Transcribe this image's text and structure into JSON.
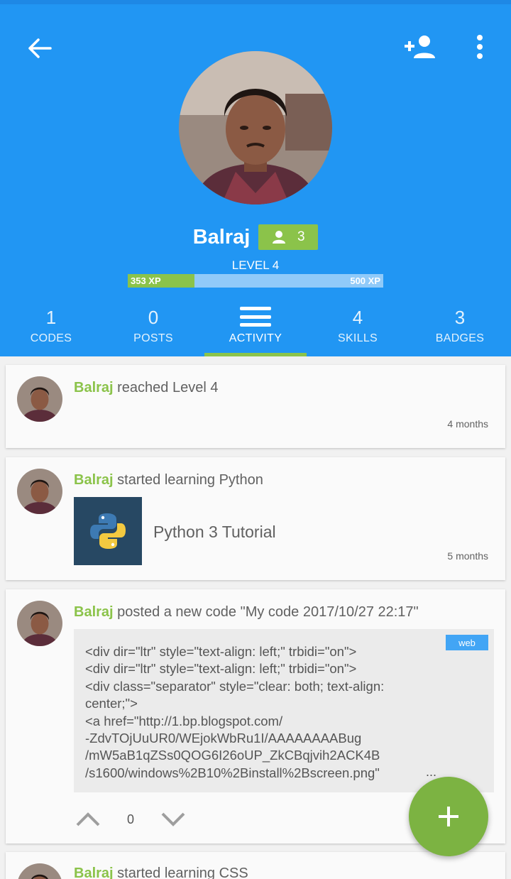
{
  "profile": {
    "name": "Balraj",
    "followers": "3",
    "level": "LEVEL 4",
    "xp_current": "353 XP",
    "xp_max": "500 XP",
    "xp_progress": 0.262
  },
  "tabs": [
    {
      "count": "1",
      "label": "CODES"
    },
    {
      "count": "0",
      "label": "POSTS"
    },
    {
      "count": "",
      "label": "ACTIVITY"
    },
    {
      "count": "4",
      "label": "SKILLS"
    },
    {
      "count": "3",
      "label": "BADGES"
    }
  ],
  "feed": [
    {
      "user": "Balraj",
      "text": " reached Level 4",
      "time": "4 months"
    },
    {
      "user": "Balraj",
      "text": " started learning Python",
      "course": "Python 3 Tutorial",
      "time": "5 months"
    },
    {
      "user": "Balraj",
      "text": " posted a new code \"My code 2017/10/27 22:17\"",
      "tag": "web",
      "code": "<div dir=\"ltr\" style=\"text-align: left;\" trbidi=\"on\">\n<div dir=\"ltr\" style=\"text-align: left;\" trbidi=\"on\">\n<div class=\"separator\" style=\"clear: both; text-align:\ncenter;\">\n<a href=\"http://1.bp.blogspot.com/\n-ZdvTOjUuUR0/WEjokWbRu1I/AAAAAAAABug\n/mW5aB1qZSs0QOG6I26oUP_ZkCBqjvih2ACK4B\n/s1600/windows%2B10%2Binstall%2Bscreen.png\"",
      "ellipsis": "...",
      "votes": "0"
    },
    {
      "user": "Balraj",
      "text": " started learning CSS"
    }
  ],
  "colors": {
    "primary": "#2196f3",
    "accent": "#8bc34a"
  }
}
